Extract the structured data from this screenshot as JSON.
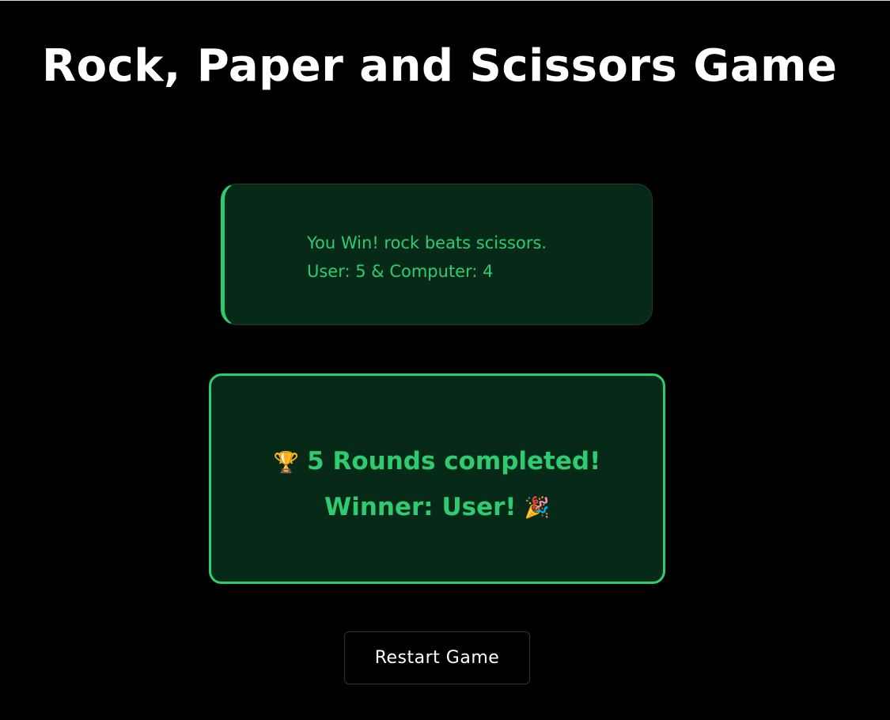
{
  "page": {
    "title": "Rock, Paper and Scissors Game"
  },
  "result": {
    "message": "You Win! rock beats scissors.",
    "score": "User: 5 & Computer: 4"
  },
  "final": {
    "rounds_text": "5 Rounds completed!",
    "winner_text": "Winner: User!",
    "trophy_icon": "🏆",
    "party_icon": "🎉"
  },
  "controls": {
    "restart_label": "Restart Game"
  },
  "colors": {
    "background": "#000000",
    "accent": "#2ecc71",
    "card_background": "#072a18"
  }
}
